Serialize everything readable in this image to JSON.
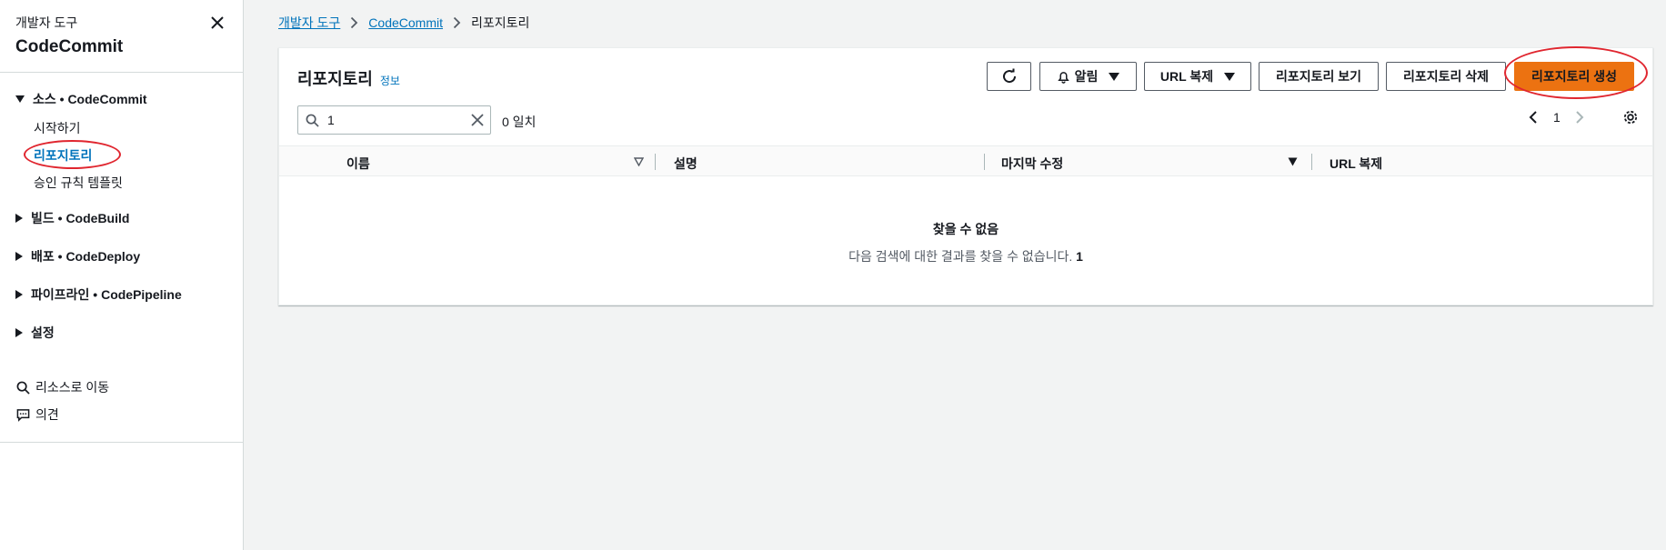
{
  "sidebar": {
    "header_sub": "개발자 도구",
    "header_title": "CodeCommit",
    "sections": [
      {
        "label": "소스 • CodeCommit",
        "expanded": true
      },
      {
        "label": "빌드 • CodeBuild",
        "expanded": false
      },
      {
        "label": "배포 • CodeDeploy",
        "expanded": false
      },
      {
        "label": "파이프라인 • CodePipeline",
        "expanded": false
      },
      {
        "label": "설정",
        "expanded": false
      }
    ],
    "source_items": [
      {
        "label": "시작하기"
      },
      {
        "label": "리포지토리",
        "active": true
      },
      {
        "label": "승인 규칙 템플릿"
      }
    ],
    "bottom_links": [
      {
        "label": "리소스로 이동",
        "icon": "search-icon"
      },
      {
        "label": "의견",
        "icon": "feedback-icon"
      }
    ]
  },
  "breadcrumb": {
    "items": [
      "개발자 도구",
      "CodeCommit"
    ],
    "current": "리포지토리"
  },
  "panel": {
    "title": "리포지토리",
    "info": "정보",
    "buttons": {
      "notify": "알림",
      "clone_url": "URL 복제",
      "view": "리포지토리 보기",
      "delete": "리포지토리 삭제",
      "create": "리포지토리 생성"
    },
    "search": {
      "value": "1"
    },
    "match_count": "0 일치",
    "page": "1",
    "columns": [
      "이름",
      "설명",
      "마지막 수정",
      "URL 복제"
    ],
    "empty": {
      "title": "찾을 수 없음",
      "desc": "다음 검색에 대한 결과를 찾을 수 없습니다.",
      "query": "1"
    }
  },
  "colors": {
    "primary": "#ec7211",
    "link": "#0073bb",
    "highlight": "#e0262f"
  }
}
